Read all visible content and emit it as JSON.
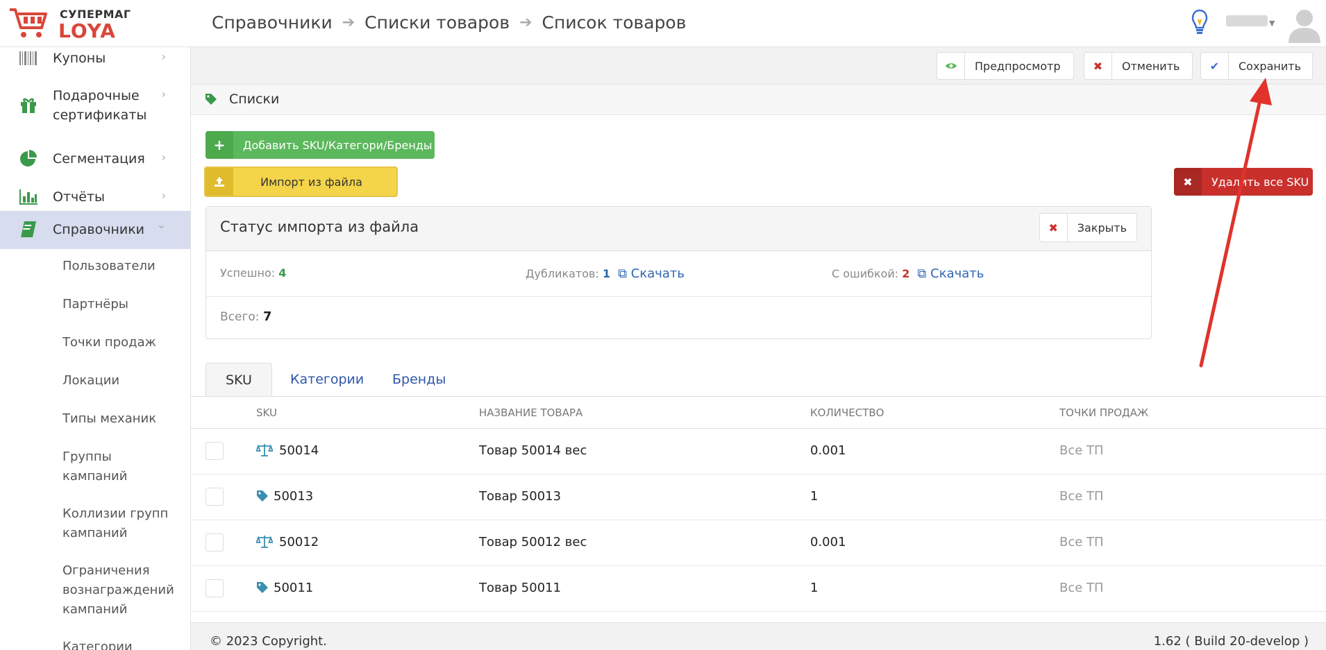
{
  "header": {
    "logo_top": "СУПЕРМАГ",
    "logo_bottom": "LOYA",
    "breadcrumb": [
      "Справочники",
      "Списки товаров",
      "Список товаров"
    ],
    "breadcrumb_sep": "➔"
  },
  "sidebar": {
    "items": [
      {
        "label": "Купоны",
        "icon": "barcode-icon"
      },
      {
        "label": "Подарочные\nсертификаты",
        "icon": "gift-icon"
      },
      {
        "label": "Сегментация",
        "icon": "pie-chart-icon"
      },
      {
        "label": "Отчёты",
        "icon": "bar-chart-icon"
      },
      {
        "label": "Справочники",
        "icon": "book-icon"
      }
    ],
    "chevron_right": "›",
    "chevron_down": "⌄",
    "subitems": [
      "Пользователи",
      "Партнёры",
      "Точки продаж",
      "Локации",
      "Типы механик",
      "Группы\nкампаний",
      "Коллизии групп\nкампаний",
      "Ограничения\nвознаграждений\nкампаний",
      "Категории"
    ]
  },
  "toolbar": {
    "preview_label": "Предпросмотр",
    "cancel_label": "Отменить",
    "save_label": "Сохранить"
  },
  "section": {
    "title": "Списки"
  },
  "actions": {
    "add_label": "Добавить SKU/Категори/Бренды",
    "import_label": "Импорт из файла",
    "delete_label": "Удалить все SKU"
  },
  "import_status": {
    "title": "Статус импорта из файла",
    "close_label": "Закрыть",
    "success_label": "Успешно:",
    "success_value": "4",
    "duplicates_label": "Дубликатов:",
    "duplicates_value": "1",
    "errors_label": "С ошибкой:",
    "errors_value": "2",
    "download_label": "Скачать",
    "total_label": "Всего:",
    "total_value": "7"
  },
  "tabs": [
    "SKU",
    "Категории",
    "Бренды"
  ],
  "table": {
    "columns": [
      "SKU",
      "НАЗВАНИЕ ТОВАРА",
      "КОЛИЧЕСТВО",
      "ТОЧКИ ПРОДАЖ"
    ],
    "rows": [
      {
        "sku": "50014",
        "name": "Товар 50014 вес",
        "qty": "0.001",
        "pos": "Все ТП",
        "icon": "scale-icon"
      },
      {
        "sku": "50013",
        "name": "Товар 50013",
        "qty": "1",
        "pos": "Все ТП",
        "icon": "tag-icon"
      },
      {
        "sku": "50012",
        "name": "Товар 50012 вес",
        "qty": "0.001",
        "pos": "Все ТП",
        "icon": "scale-icon"
      },
      {
        "sku": "50011",
        "name": "Товар 50011",
        "qty": "1",
        "pos": "Все ТП",
        "icon": "tag-icon"
      }
    ]
  },
  "footer": {
    "copyright": "© 2023 Copyright.",
    "build": "1.62 ( Build 20-develop )"
  },
  "colors": {
    "brand_red": "#d9463a",
    "success_green": "#5cb85c",
    "warning_yellow": "#f4d449",
    "danger_red": "#c9302c",
    "link_blue": "#2e67b1",
    "active_nav": "#d7dcef"
  }
}
